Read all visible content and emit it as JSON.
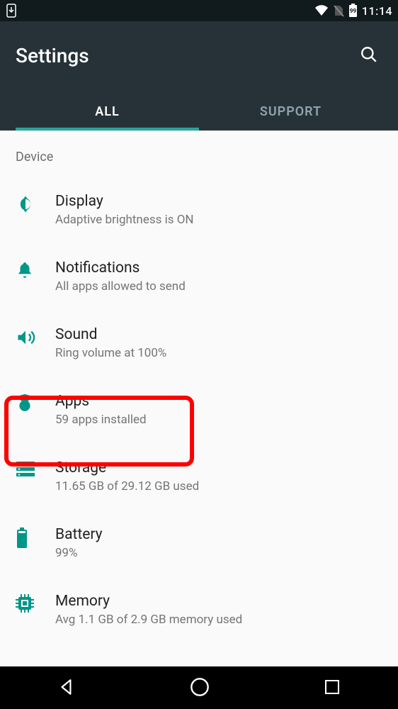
{
  "status": {
    "time": "11:14",
    "battery_label": "99"
  },
  "appbar": {
    "title": "Settings"
  },
  "tabs": {
    "all": "ALL",
    "support": "SUPPORT",
    "active": "all"
  },
  "section": {
    "header": "Device"
  },
  "items": [
    {
      "icon": "display",
      "title": "Display",
      "sub": "Adaptive brightness is ON"
    },
    {
      "icon": "notifications",
      "title": "Notifications",
      "sub": "All apps allowed to send"
    },
    {
      "icon": "sound",
      "title": "Sound",
      "sub": "Ring volume at 100%"
    },
    {
      "icon": "apps",
      "title": "Apps",
      "sub": "59 apps installed"
    },
    {
      "icon": "storage",
      "title": "Storage",
      "sub": "11.65 GB of 29.12 GB used"
    },
    {
      "icon": "battery",
      "title": "Battery",
      "sub": "99%"
    },
    {
      "icon": "memory",
      "title": "Memory",
      "sub": "Avg 1.1 GB of 2.9 GB memory used"
    }
  ],
  "highlight_index": 3
}
